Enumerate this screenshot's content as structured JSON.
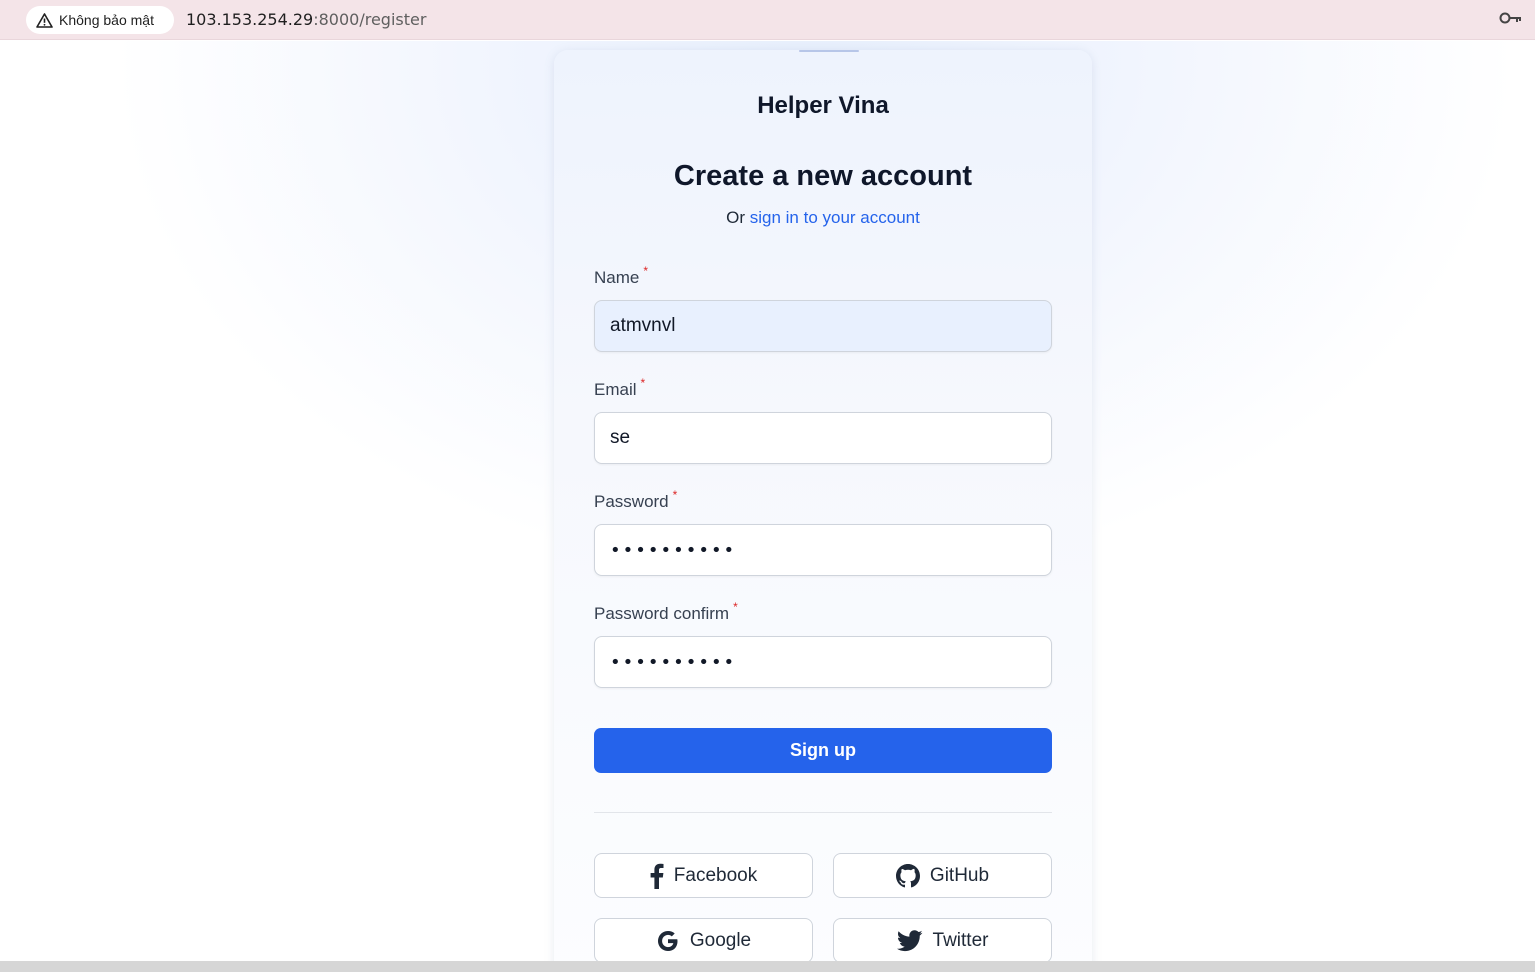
{
  "browser": {
    "security_label": "Không bảo mật",
    "url_host": "103.153.254.29",
    "url_path": ":8000/register"
  },
  "card": {
    "brand": "Helper Vina",
    "heading": "Create a new account",
    "subheading_prefix": "Or",
    "signin_link": "sign in to your account"
  },
  "form": {
    "required_marker": "*",
    "name": {
      "label": "Name",
      "value": "atmvnvl"
    },
    "email": {
      "label": "Email",
      "value": "se"
    },
    "password": {
      "label": "Password",
      "value": "••••••••••"
    },
    "password_confirm": {
      "label": "Password confirm",
      "value": "••••••••••"
    },
    "submit_label": "Sign up"
  },
  "social": {
    "facebook": "Facebook",
    "github": "GitHub",
    "google": "Google",
    "twitter": "Twitter"
  },
  "colors": {
    "primary": "#2563eb",
    "required": "#dc2626",
    "autofill_bg": "#e8f0fe"
  }
}
